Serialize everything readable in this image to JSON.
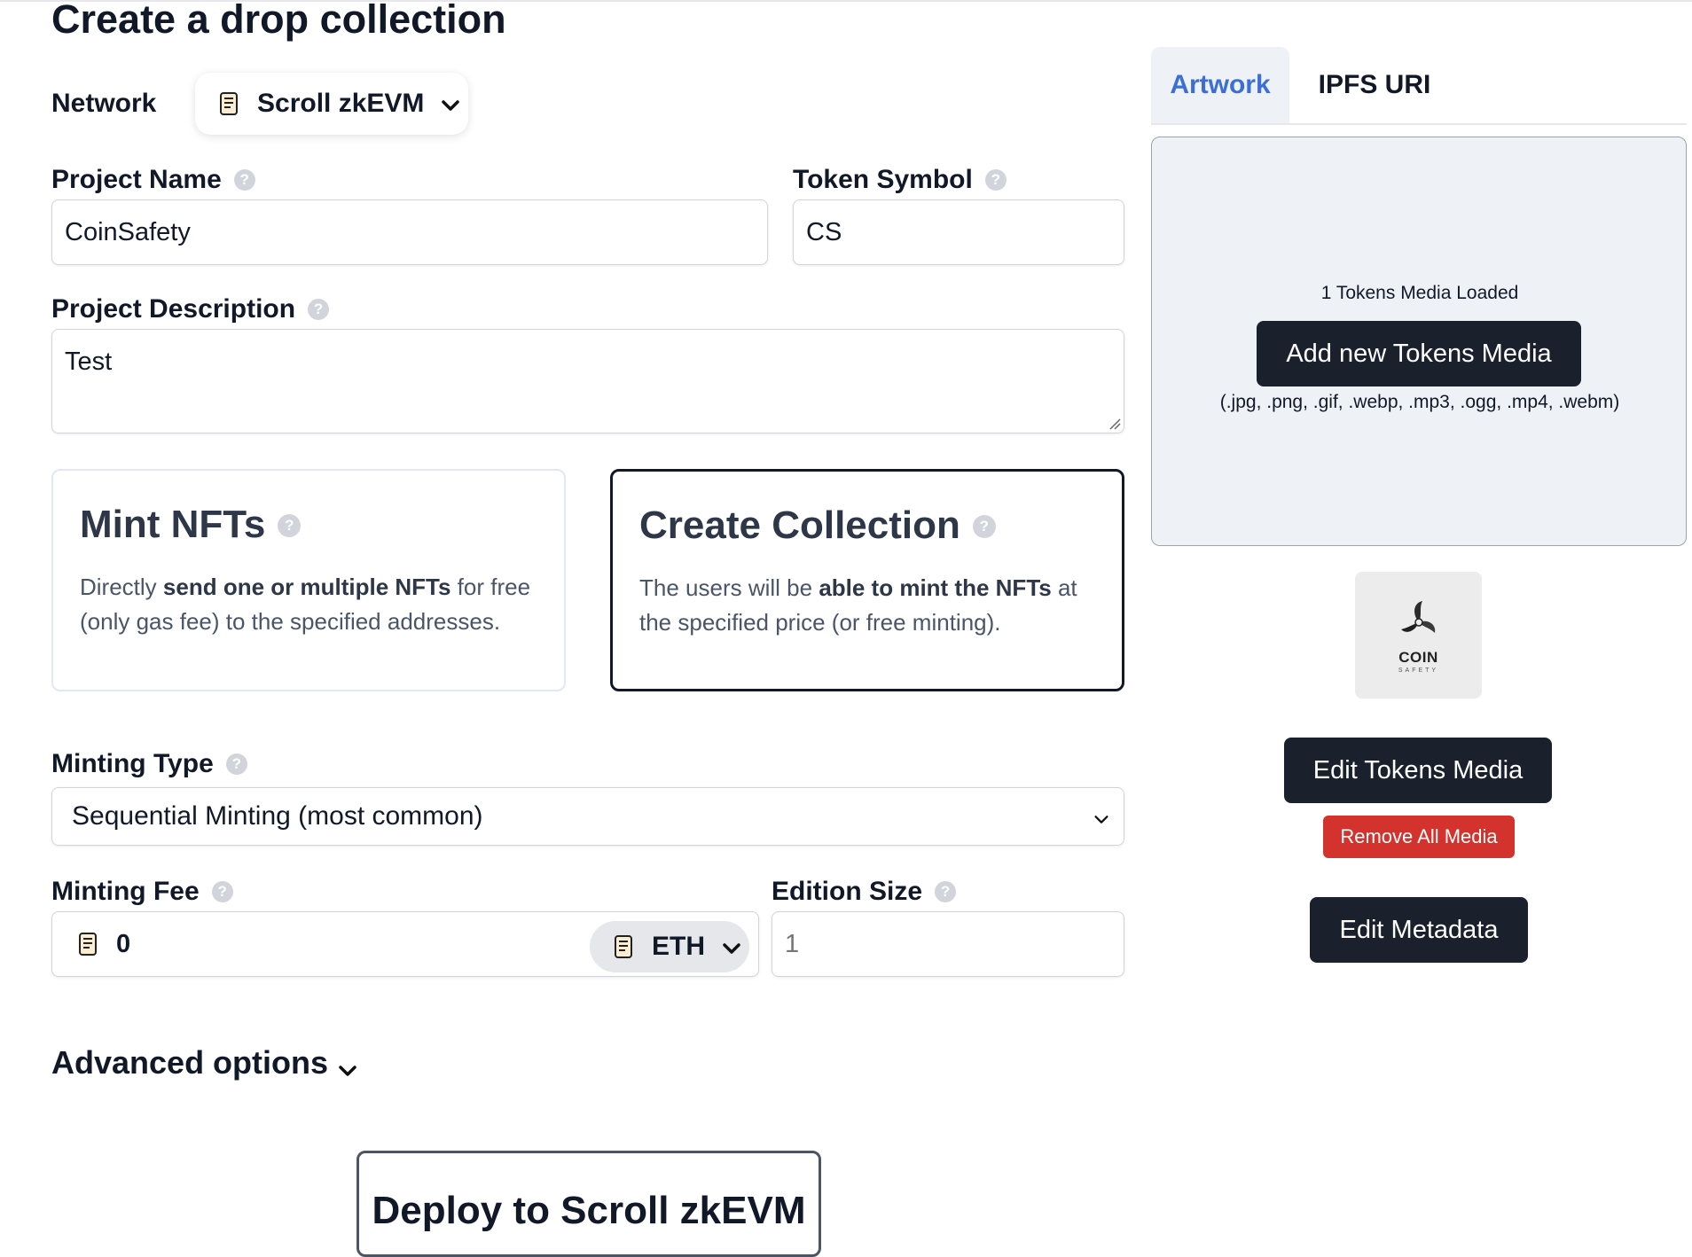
{
  "page": {
    "title": "Create a drop collection"
  },
  "network": {
    "label": "Network",
    "selected": "Scroll zkEVM",
    "icon": "scroll-icon"
  },
  "project_name": {
    "label": "Project Name",
    "value": "CoinSafety"
  },
  "token_symbol": {
    "label": "Token Symbol",
    "value": "CS"
  },
  "project_description": {
    "label": "Project Description",
    "value": "Test"
  },
  "mode_cards": {
    "mint": {
      "title": "Mint NFTs",
      "desc_pre": "Directly ",
      "desc_bold": "send one or multiple NFTs",
      "desc_post": " for free (only gas fee) to the specified addresses.",
      "selected": false
    },
    "create": {
      "title": "Create Collection",
      "desc_pre": "The users will be ",
      "desc_bold": "able to mint the NFTs",
      "desc_post": " at the specified price (or free minting).",
      "selected": true
    }
  },
  "minting_type": {
    "label": "Minting Type",
    "selected": "Sequential Minting (most common)"
  },
  "minting_fee": {
    "label": "Minting Fee",
    "value": "0",
    "currency": "ETH"
  },
  "edition_size": {
    "label": "Edition Size",
    "placeholder": "1"
  },
  "help_glyph": "?",
  "advanced": {
    "label": "Advanced options"
  },
  "deploy": {
    "label": "Deploy to Scroll zkEVM"
  },
  "right_panel": {
    "tabs": [
      {
        "label": "Artwork",
        "active": true
      },
      {
        "label": "IPFS URI",
        "active": false
      }
    ],
    "dropzone": {
      "count_text": "1 Tokens Media Loaded",
      "add_button": "Add new Tokens Media",
      "formats": "(.jpg, .png, .gif, .webp, .mp3, .ogg, .mp4, .webm)"
    },
    "thumbnail": {
      "text": "COIN",
      "subtext": "SAFETY"
    },
    "edit_media_button": "Edit Tokens Media",
    "remove_media_button": "Remove All Media",
    "edit_metadata_button": "Edit Metadata"
  },
  "colors": {
    "accent_blue": "#3b6fd6",
    "dark_button": "#1a202c",
    "danger": "#d3322d",
    "panel_bg": "#eef1f6"
  }
}
